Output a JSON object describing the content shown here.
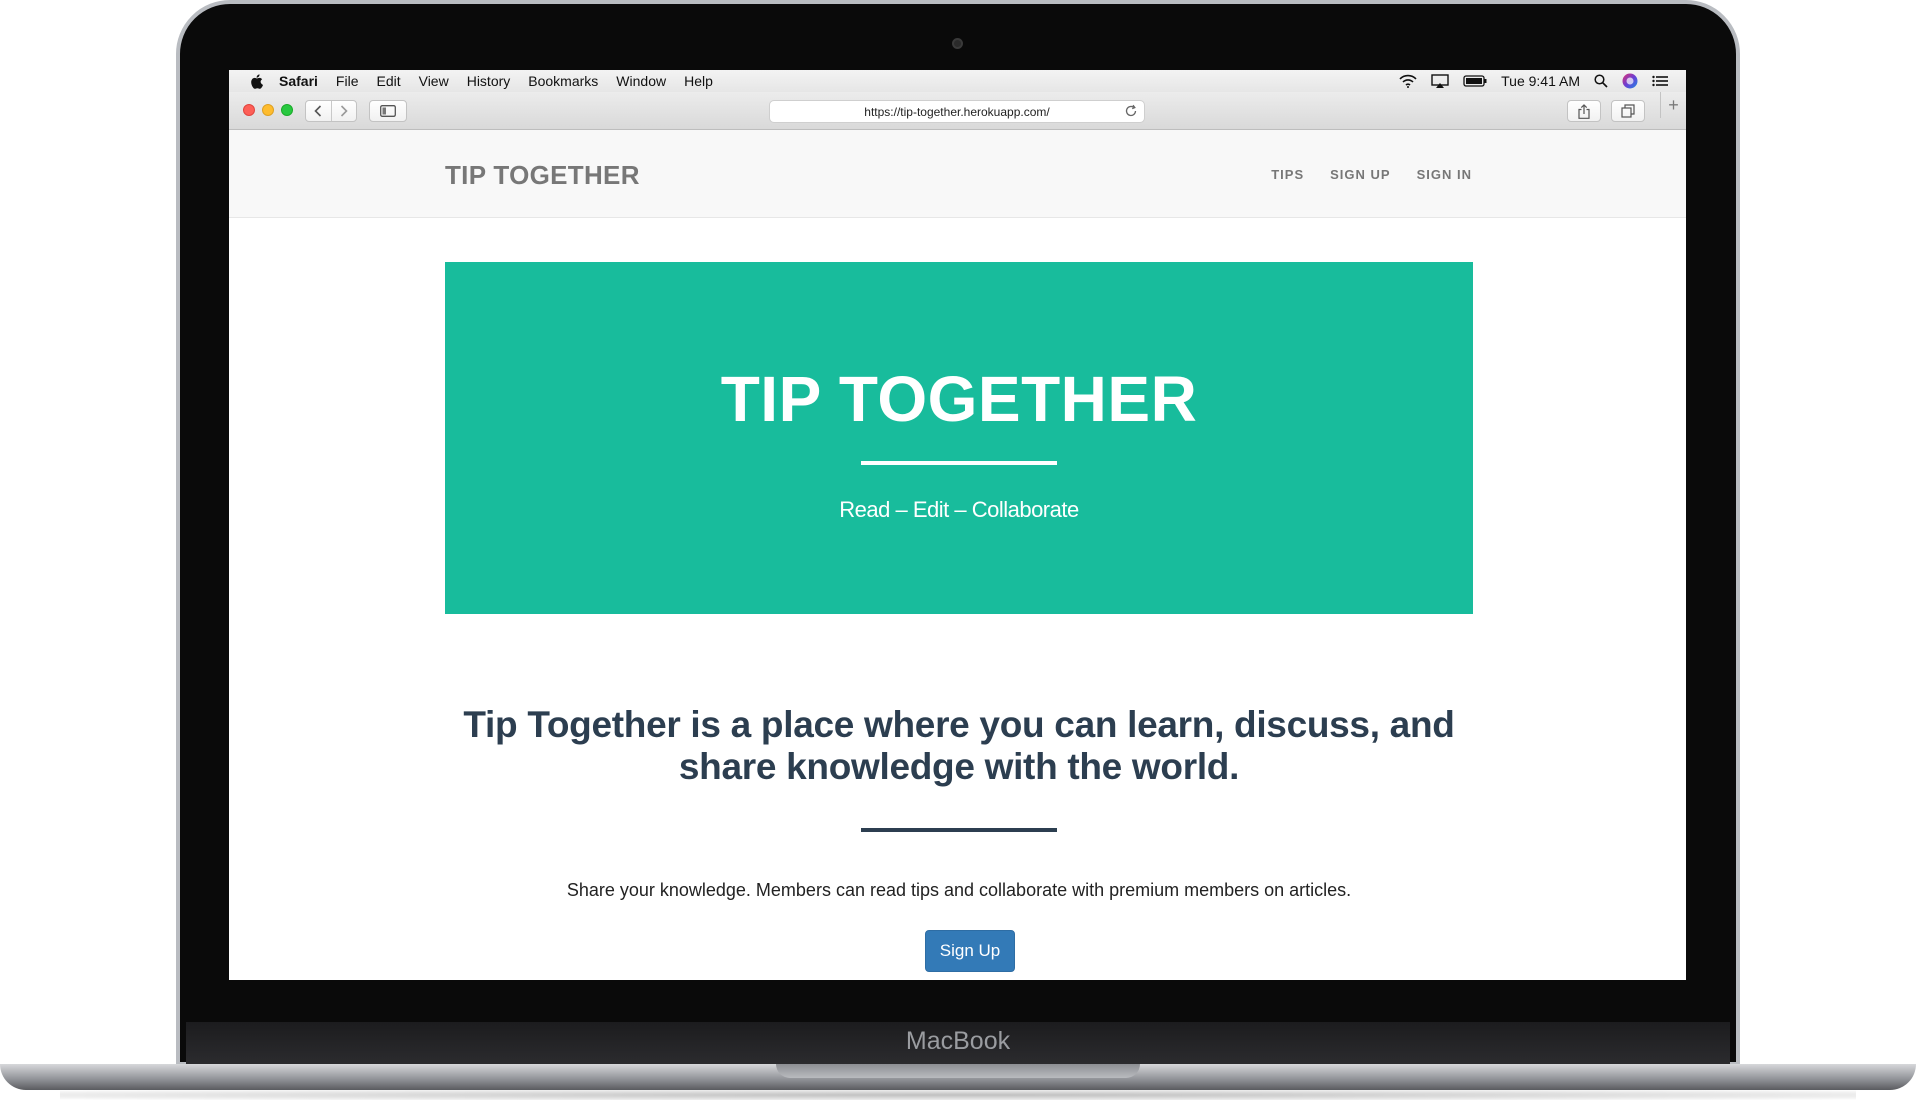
{
  "device": {
    "brand_label": "MacBook"
  },
  "menubar": {
    "app_name": "Safari",
    "items": [
      "File",
      "Edit",
      "View",
      "History",
      "Bookmarks",
      "Window",
      "Help"
    ],
    "clock": "Tue 9:41 AM",
    "status_icons": [
      "wifi-icon",
      "airplay-icon",
      "battery-icon",
      "spotlight-search-icon",
      "siri-icon",
      "notification-center-icon"
    ]
  },
  "browser": {
    "url": "https://tip-together.herokuapp.com/",
    "toolbar_icons": [
      "back-icon",
      "forward-icon",
      "sidebar-icon",
      "reload-icon",
      "share-icon",
      "tabs-overview-icon",
      "new-tab-icon"
    ]
  },
  "site": {
    "brand": "TIP TOGETHER",
    "nav": [
      "TIPS",
      "SIGN UP",
      "SIGN IN"
    ],
    "hero": {
      "title": "TIP TOGETHER",
      "subtitle": "Read – Edit – Collaborate",
      "background_color": "#18bc9c"
    },
    "lead": "Tip Together is a place where you can learn, discuss, and share knowledge with the world.",
    "description": "Share your knowledge. Members can read tips and collaborate with premium members on articles.",
    "cta_label": "Sign Up",
    "cta_color": "#337ab7"
  }
}
